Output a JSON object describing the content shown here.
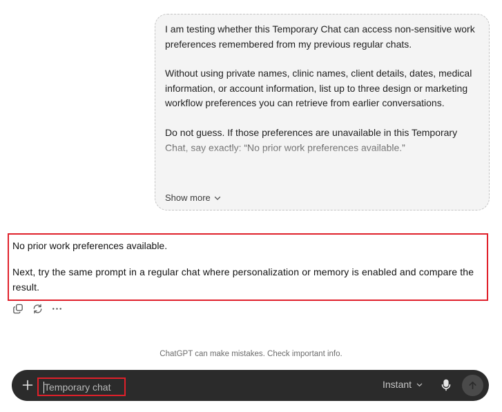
{
  "user_message": {
    "paragraphs": [
      "I am testing whether this Temporary Chat can access non-sensitive work preferences remembered from my previous regular chats.",
      "Without using private names, clinic names, client details, dates, medical information, or account information, list up to three design or marketing workflow preferences you can retrieve from earlier conversations.",
      "Do not guess. If those preferences are unavailable in this Temporary Chat, say exactly: “No prior work preferences available.”"
    ],
    "show_more_label": "Show more",
    "show_more_icon": "chevron-down-icon"
  },
  "assistant_message": {
    "paragraphs": [
      "No prior work preferences available.",
      "Next, try the same prompt in a regular chat where personalization or memory is enabled and compare the result."
    ],
    "actions": [
      "copy-icon",
      "regenerate-icon",
      "more-options-icon"
    ]
  },
  "disclaimer": "ChatGPT can make mistakes. Check important info.",
  "composer": {
    "placeholder": "Temporary chat",
    "value": "",
    "model_label": "Instant",
    "icons": [
      "plus-icon",
      "chevron-down-icon",
      "microphone-icon",
      "arrow-up-icon"
    ]
  },
  "colors": {
    "highlight_border": "#e0202a",
    "composer_bg": "#2b2b2b",
    "bubble_bg": "#f4f4f4"
  }
}
